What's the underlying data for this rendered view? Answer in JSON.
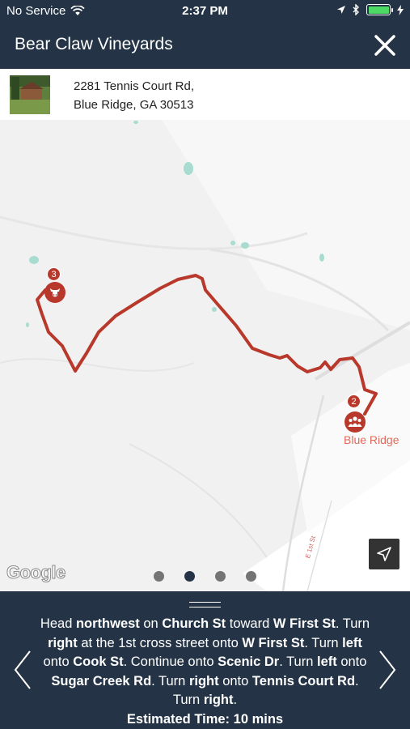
{
  "status_bar": {
    "carrier": "No Service",
    "time": "2:37 PM"
  },
  "header": {
    "title": "Bear Claw Vineyards"
  },
  "address": {
    "line1": "2281 Tennis Court Rd,",
    "line2": "Blue Ridge, GA 30513"
  },
  "map": {
    "markers": [
      {
        "number": "3",
        "icon": "cow-icon"
      },
      {
        "number": "2",
        "icon": "group-icon"
      }
    ],
    "place_label": "Blue Ridge",
    "street_label": "E 1st St",
    "attribution": "Google",
    "route_color": "#b8382b",
    "page_dots": 4,
    "active_dot": 2
  },
  "directions": {
    "steps": [
      {
        "t": "Head "
      },
      {
        "b": "northwest"
      },
      {
        "t": " on "
      },
      {
        "b": "Church St"
      },
      {
        "t": " toward "
      },
      {
        "b": "W First St"
      },
      {
        "t": ". Turn "
      },
      {
        "b": "right"
      },
      {
        "t": " at the 1st cross street onto "
      },
      {
        "b": "W First St"
      },
      {
        "t": ". Turn "
      },
      {
        "b": "left"
      },
      {
        "t": " onto "
      },
      {
        "b": "Cook St"
      },
      {
        "t": ". Continue onto "
      },
      {
        "b": "Scenic Dr"
      },
      {
        "t": ". Turn "
      },
      {
        "b": "left"
      },
      {
        "t": " onto "
      },
      {
        "b": "Sugar Creek Rd"
      },
      {
        "t": ". Turn "
      },
      {
        "b": "right"
      },
      {
        "t": " onto "
      },
      {
        "b": "Tennis Court Rd"
      },
      {
        "t": ". Turn "
      },
      {
        "b": "right"
      },
      {
        "t": "."
      }
    ],
    "estimated_time": "Estimated Time: 10 mins"
  },
  "colors": {
    "nav_bg": "#243446",
    "accent": "#b8382b",
    "battery": "#4cd964"
  }
}
